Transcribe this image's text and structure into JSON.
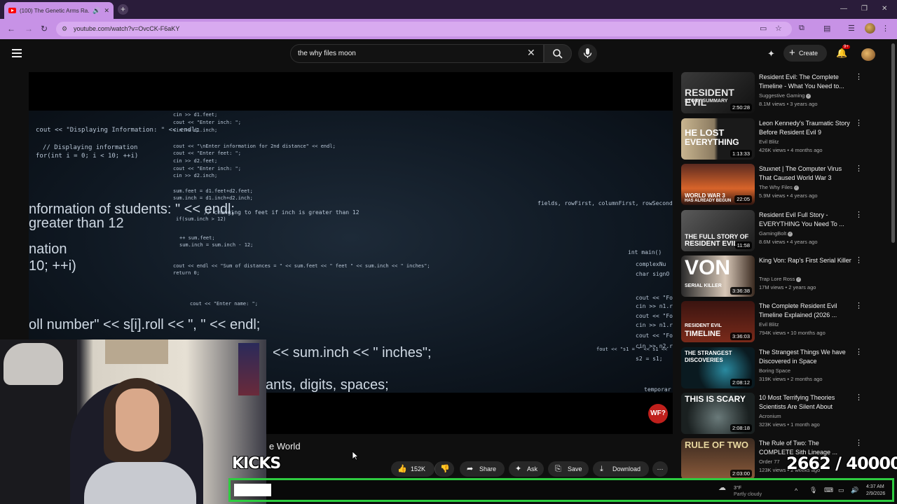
{
  "browser": {
    "tab_title": "(100) The Genetic Arms Ra...",
    "url": "youtube.com/watch?v=OvcCK-F6aKY",
    "new_tab_label": "+"
  },
  "masthead": {
    "search_value": "the why files moon",
    "create_label": "Create",
    "notification_count": "9+"
  },
  "player": {
    "badge": "WF?",
    "code_lines": [
      "cin >> d1.feet;",
      "cout << \"Enter inch: \";",
      "cin >> d1.inch;",
      "cout << \"Displaying Information: \" << endl;",
      "// Displaying information",
      "for(int i = 0; i < 10; ++i)",
      "cout << \"\\nEnter information for 2nd distance\" << endl;",
      "cout << \"Enter feet: \";",
      "cin >> d2.feet;",
      "cout << \"Enter inch: \";",
      "cin >> d2.inch;",
      "sum.feet = d1.feet+d2.feet;",
      "sum.inch = d1.inch+d2.inch;",
      "nformation of students: \" << endl;",
      " greater than 12",
      "// changing to feet if inch is greater than 12",
      "if(sum.inch > 12)",
      "nation",
      "++ sum.feet;",
      "sum.inch = sum.inch - 12;",
      "10; ++i)",
      "cout << endl << \"Sum of distances = \" << sum.feet << \" feet  \" << sum.inch << \" inches\";",
      "return 0;",
      "oll number\" << s[i].roll << \", \" << endl;",
      "<< sum.inch << \" inches\";",
      "ants, digits, spaces;",
      "int main()",
      "complexNu",
      "char signO",
      "cout << \"Fo",
      "cin >> n1.r",
      "cout << \"Fo",
      "cin >> n1.re",
      "cout << \"Fo",
      "cin >> n2.r",
      "s2 = s1;",
      "fout << \"s1 = \" << s1 <<",
      "temporar",
      "cout << \"Enter name: \";",
      "fields, rowFirst, columnFirst, rowSecond,"
    ]
  },
  "video": {
    "title_partial": "e World",
    "actions": {
      "like_count": "152K",
      "share": "Share",
      "ask": "Ask",
      "save": "Save",
      "download": "Download"
    }
  },
  "related": [
    {
      "title": "Resident Evil: The Complete Timeline - What You Need to...",
      "channel": "Suggestive Gaming",
      "verified": true,
      "meta": "8.1M views • 3 years ago",
      "duration": "2:50:28",
      "thumb_text": "RESIDENT EVIL",
      "thumb_sub": "STORY SUMMARY"
    },
    {
      "title": "Leon Kennedy's Traumatic Story Before Resident Evil 9",
      "channel": "Evil Blitz",
      "verified": false,
      "meta": "426K views • 4 months ago",
      "duration": "1:13:33",
      "thumb_text": "HE LOST",
      "thumb_sub": "EVERYTHING"
    },
    {
      "title": "Stuxnet | The Computer Virus That Caused World War 3",
      "channel": "The Why Files",
      "verified": true,
      "meta": "5.9M views • 4 years ago",
      "duration": "22:05",
      "thumb_text": "WORLD WAR 3",
      "thumb_sub": "HAS ALREADY BEGUN"
    },
    {
      "title": "Resident Evil Full Story - EVERYTHING You Need To ...",
      "channel": "GamingBolt",
      "verified": true,
      "meta": "8.6M views • 4 years ago",
      "duration": "11:58",
      "thumb_text": "THE FULL STORY OF",
      "thumb_sub": "RESIDENT EVIL"
    },
    {
      "title": "King Von: Rap's First Serial Killer",
      "channel": "Trap Lore Ross",
      "verified": true,
      "meta": "17M views • 2 years ago",
      "duration": "3:36:38",
      "thumb_text": "VON",
      "thumb_sub": "SERIAL KILLER"
    },
    {
      "title": "The Complete Resident Evil Timeline Explained (2026 ...",
      "channel": "Evil Blitz",
      "verified": false,
      "meta": "794K views • 10 months ago",
      "duration": "3:36:03",
      "thumb_text": "RESIDENT EVIL",
      "thumb_sub": "TIMELINE"
    },
    {
      "title": "The Strangest Things We have Discovered in Space",
      "channel": "Boring Space",
      "verified": false,
      "meta": "319K views • 2 months ago",
      "duration": "2:08:12",
      "thumb_text": "THE STRANGEST",
      "thumb_sub": "DISCOVERIES"
    },
    {
      "title": "10 Most Terrifying Theories Scientists Are Silent About",
      "channel": "Acronium",
      "verified": false,
      "meta": "323K views • 1 month ago",
      "duration": "2:08:18",
      "thumb_text": "THIS IS SCARY",
      "thumb_sub": ""
    },
    {
      "title": "The Rule of Two: The COMPLETE Sith Lineage ...",
      "channel": "Order 77",
      "verified": false,
      "meta": "123K views • 2 weeks ago",
      "duration": "2:03:00",
      "thumb_text": "RULE OF TWO",
      "thumb_sub": ""
    }
  ],
  "overlay": {
    "kicks_label": "KICKS",
    "goal_counter": "2662  / 40000",
    "progress_fraction": 0.057
  },
  "taskbar": {
    "weather_temp": "3°F",
    "weather_desc": "Partly cloudy",
    "time": "4:37 AM",
    "date": "2/9/2026"
  },
  "colors": {
    "accent_purple": "#c792e6",
    "youtube_red": "#ff0000",
    "progress_border": "#2ecc40",
    "bg": "#0f0f0f"
  }
}
